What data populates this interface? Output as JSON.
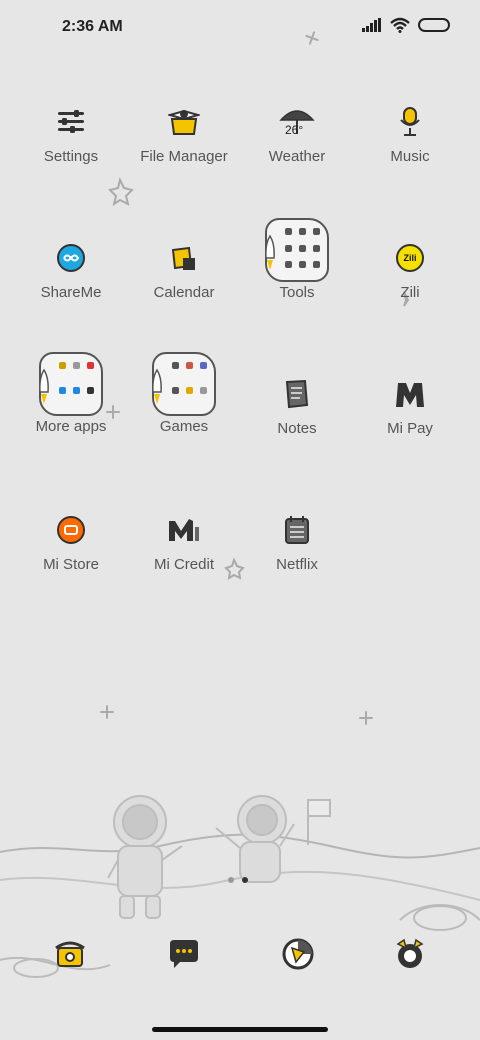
{
  "status_bar": {
    "time": "2:36 AM"
  },
  "apps": [
    {
      "label": "Settings"
    },
    {
      "label": "File Manager"
    },
    {
      "label": "Weather",
      "temp": "26°"
    },
    {
      "label": "Music"
    },
    {
      "label": "ShareMe"
    },
    {
      "label": "Calendar"
    },
    {
      "label": "Tools"
    },
    {
      "label": "Zili",
      "badge": "Zili"
    },
    {
      "label": "More apps"
    },
    {
      "label": "Games"
    },
    {
      "label": "Notes"
    },
    {
      "label": "Mi Pay"
    },
    {
      "label": "Mi Store"
    },
    {
      "label": "Mi Credit"
    },
    {
      "label": "Netflix"
    }
  ],
  "page_indicator": {
    "count": 2,
    "active": 2
  },
  "dock": [
    {
      "name": "phone-icon"
    },
    {
      "name": "messages-icon"
    },
    {
      "name": "browser-icon"
    },
    {
      "name": "camera-icon"
    }
  ],
  "colors": {
    "background": "#e6e6e6",
    "accent": "#f5c400",
    "store": "#ff6a00",
    "shareme": "#1ea7e1"
  }
}
